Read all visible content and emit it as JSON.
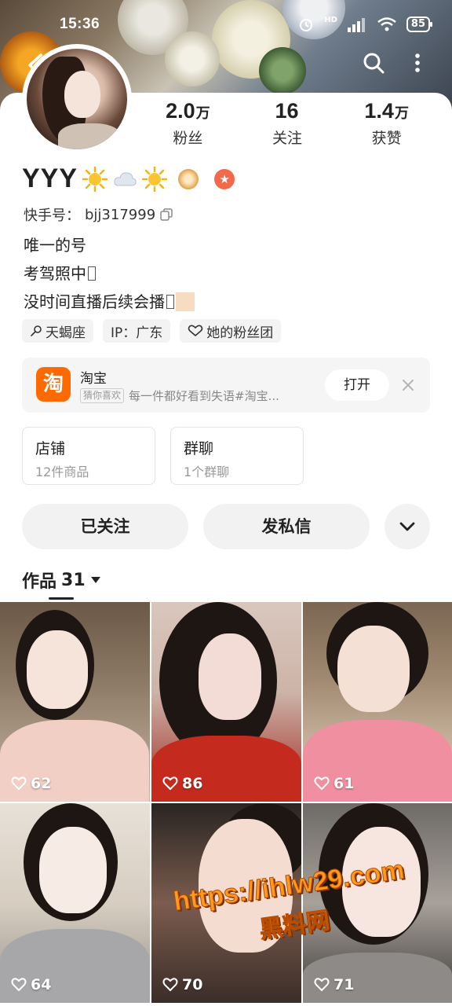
{
  "status_bar": {
    "time": "15:36",
    "network_label": "HD",
    "battery": "85"
  },
  "header": {
    "back_icon": "chevron-left-icon",
    "search_icon": "search-icon",
    "more_icon": "more-dots-icon"
  },
  "profile": {
    "name": "YYY",
    "name_emojis": [
      "sun-emoji",
      "cloud-emoji",
      "sun-emoji"
    ],
    "stats": [
      {
        "value": "2.0",
        "unit": "万",
        "label": "粉丝"
      },
      {
        "value": "16",
        "unit": "",
        "label": "关注"
      },
      {
        "value": "1.4",
        "unit": "万",
        "label": "获赞"
      }
    ],
    "kuaishou_id_label": "快手号：",
    "kuaishou_id": "bjj317999",
    "bio_lines": [
      "唯一的号",
      "考驾照中",
      "没时间直播后续会播"
    ],
    "tags": [
      {
        "icon": "scorpio-icon",
        "label": "天蝎座"
      },
      {
        "icon": "",
        "label": "IP：广东"
      },
      {
        "icon": "heart-outline-icon",
        "label": "她的粉丝团"
      }
    ]
  },
  "taobao_card": {
    "logo_text": "淘",
    "title": "淘宝",
    "chip": "猜你喜欢",
    "subtitle": "每一件都好看到失语#淘宝...",
    "open_label": "打开"
  },
  "mini_cards": [
    {
      "title": "店铺",
      "subtitle": "12件商品"
    },
    {
      "title": "群聊",
      "subtitle": "1个群聊"
    }
  ],
  "actions": {
    "follow_label": "已关注",
    "message_label": "发私信"
  },
  "works": {
    "tab_label": "作品",
    "count": "31",
    "items": [
      {
        "likes": "62"
      },
      {
        "likes": "86"
      },
      {
        "likes": "61"
      },
      {
        "likes": "64"
      },
      {
        "likes": "70"
      },
      {
        "likes": "71"
      }
    ]
  },
  "watermark": {
    "line1": "https://ihlw29.com",
    "line2": "黑料网"
  },
  "colors": {
    "taobao_orange": "#ff6a00",
    "badge_red": "#f26a4b",
    "watermark_orange": "#ff9a1f"
  }
}
